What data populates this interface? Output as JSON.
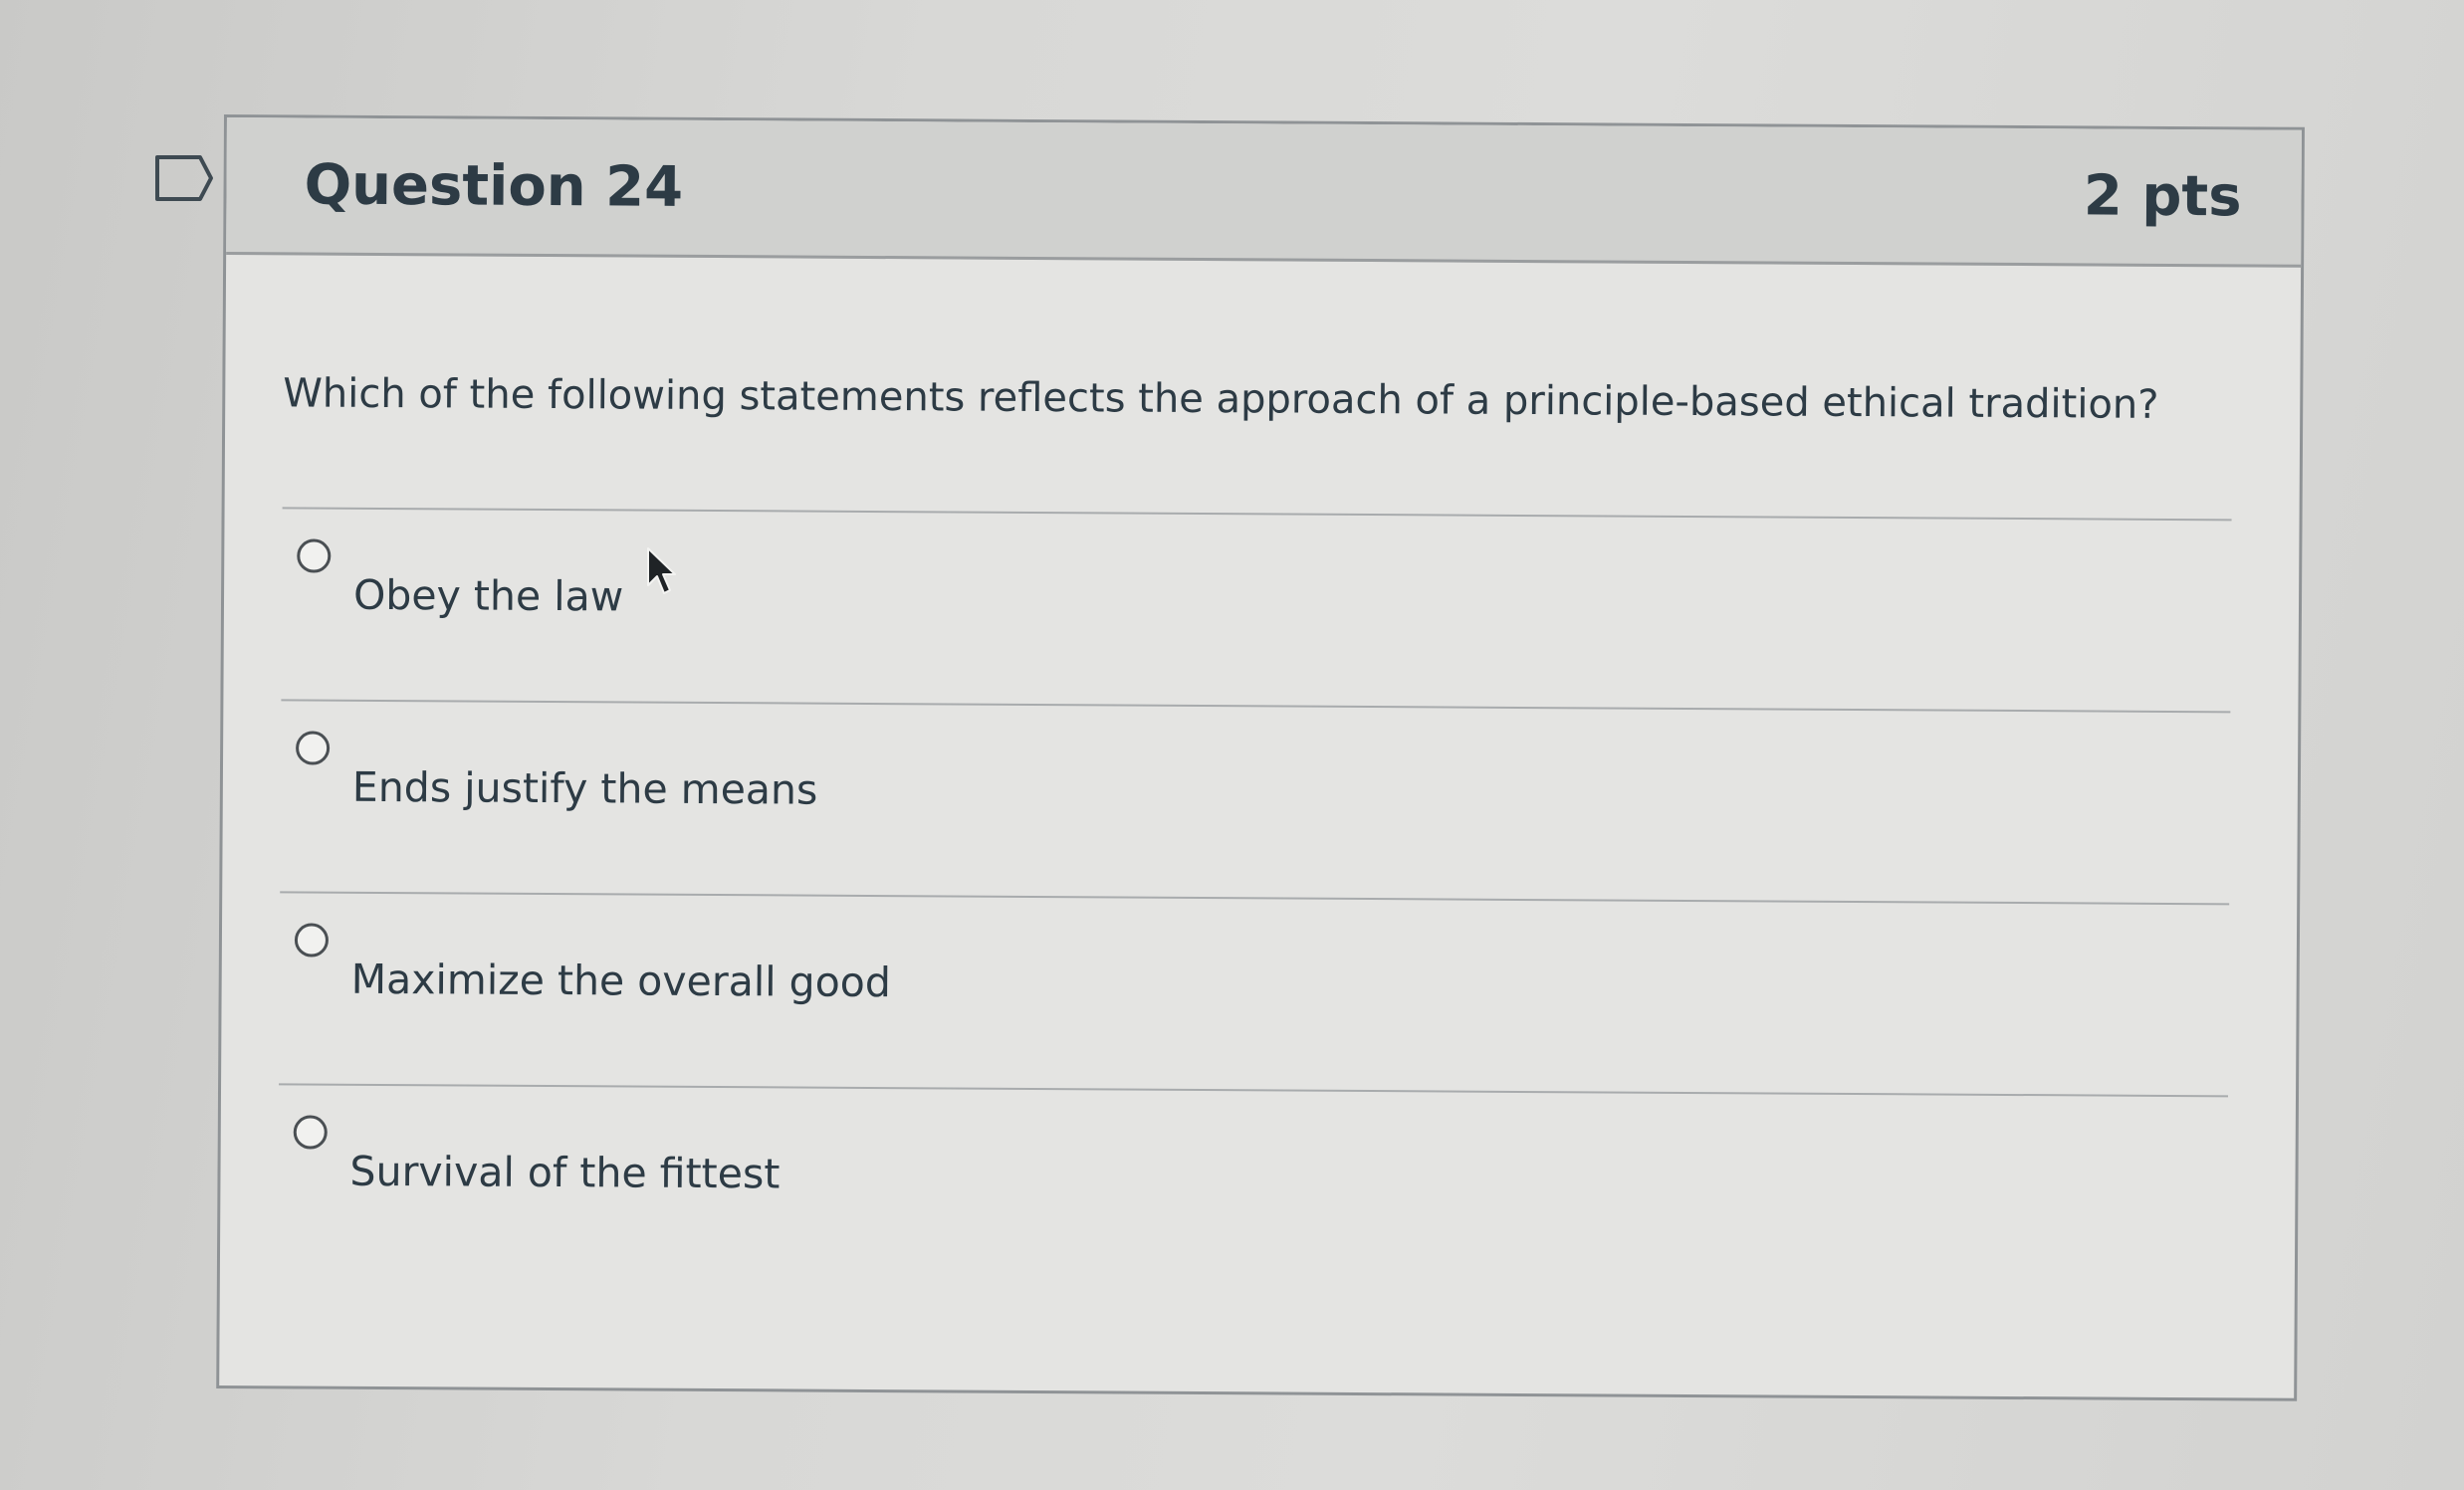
{
  "question": {
    "title": "Question 24",
    "points": "2 pts",
    "text": "Which of the following statements reflects the approach of a principle-based ethical tradition?",
    "answers": [
      {
        "label": "Obey the law"
      },
      {
        "label": "Ends justify the means"
      },
      {
        "label": "Maximize the overall good"
      },
      {
        "label": "Survival of the fittest"
      }
    ]
  },
  "icons": {
    "flag": "flag-outline-icon",
    "cursor": "mouse-pointer-icon",
    "radio": "radio-unselected-icon"
  },
  "colors": {
    "text": "#2d3b45",
    "header_background": "#d0d1cf",
    "card_background": "#e4e4e2",
    "border": "#8f9396"
  }
}
